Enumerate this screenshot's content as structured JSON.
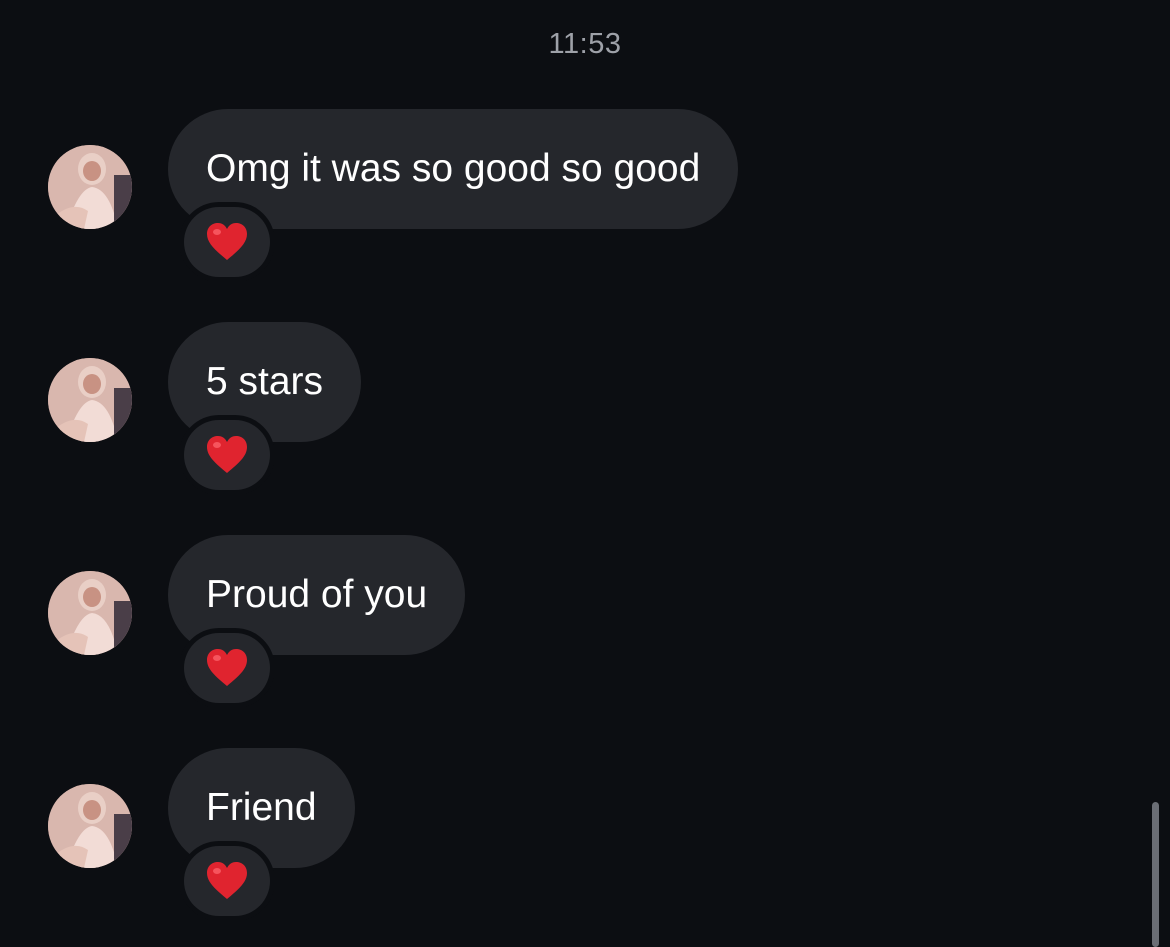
{
  "timestamp": "11:53",
  "messages": [
    {
      "text": "Omg it was so good so good",
      "reaction": "heart"
    },
    {
      "text": "5 stars",
      "reaction": "heart"
    },
    {
      "text": "Proud of you",
      "reaction": "heart"
    },
    {
      "text": "Friend",
      "reaction": "heart"
    }
  ],
  "colors": {
    "background": "#0c0e12",
    "bubble": "#25272c",
    "text": "#ffffff",
    "timestamp": "#9ea1a8",
    "heart": "#e0242f"
  },
  "icons": {
    "reaction": "heart-emoji-icon",
    "avatar": "profile-avatar"
  }
}
